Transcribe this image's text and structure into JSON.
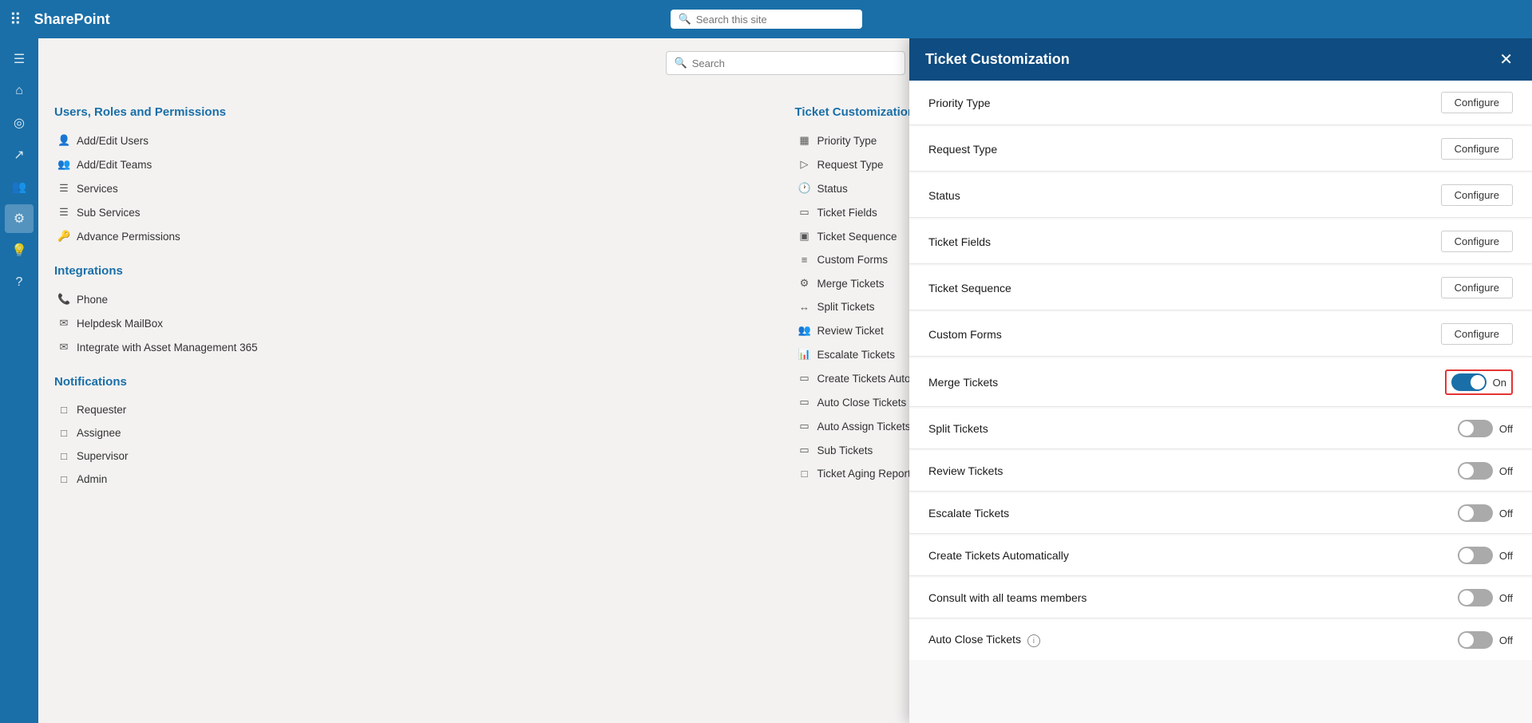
{
  "topbar": {
    "brand": "SharePoint",
    "search_placeholder": "Search this site"
  },
  "sidebar": {
    "icons": [
      {
        "name": "hamburger-icon",
        "symbol": "☰"
      },
      {
        "name": "home-icon",
        "symbol": "⌂"
      },
      {
        "name": "globe-icon",
        "symbol": "◎"
      },
      {
        "name": "chart-icon",
        "symbol": "↗"
      },
      {
        "name": "people-icon",
        "symbol": "👥"
      },
      {
        "name": "settings-icon",
        "symbol": "⚙",
        "active": true
      },
      {
        "name": "bulb-icon",
        "symbol": "💡"
      },
      {
        "name": "help-icon",
        "symbol": "?"
      }
    ]
  },
  "content_search": {
    "placeholder": "Search"
  },
  "sections": [
    {
      "id": "users-roles",
      "title": "Users, Roles and Permissions",
      "items": [
        {
          "label": "Add/Edit Users",
          "icon": "👤"
        },
        {
          "label": "Add/Edit Teams",
          "icon": "👥"
        },
        {
          "label": "Services",
          "icon": "☰"
        },
        {
          "label": "Sub Services",
          "icon": "☰"
        },
        {
          "label": "Advance Permissions",
          "icon": "🔑"
        }
      ]
    },
    {
      "id": "integrations",
      "title": "Integrations",
      "items": [
        {
          "label": "Phone",
          "icon": "📞"
        },
        {
          "label": "Helpdesk MailBox",
          "icon": "✉"
        },
        {
          "label": "Integrate with Asset Management 365",
          "icon": "✉"
        }
      ]
    },
    {
      "id": "notifications",
      "title": "Notifications",
      "items": [
        {
          "label": "Requester",
          "icon": "□"
        },
        {
          "label": "Assignee",
          "icon": "□"
        },
        {
          "label": "Supervisor",
          "icon": "□"
        },
        {
          "label": "Admin",
          "icon": "□"
        }
      ]
    }
  ],
  "ticket_section": {
    "title": "Ticket Customization",
    "items": [
      {
        "label": "Priority Type",
        "icon": "▦"
      },
      {
        "label": "Request Type",
        "icon": "▷"
      },
      {
        "label": "Status",
        "icon": "🕐"
      },
      {
        "label": "Ticket Fields",
        "icon": "▭"
      },
      {
        "label": "Ticket Sequence",
        "icon": "▣"
      },
      {
        "label": "Custom Forms",
        "icon": "≡"
      },
      {
        "label": "Merge Tickets",
        "icon": "⚙"
      },
      {
        "label": "Split Tickets",
        "icon": "↔"
      },
      {
        "label": "Review Ticket",
        "icon": "👥"
      },
      {
        "label": "Escalate Tickets",
        "icon": "📊"
      },
      {
        "label": "Create Tickets Automa...",
        "icon": "▭"
      },
      {
        "label": "Auto Close Tickets",
        "icon": "▭"
      },
      {
        "label": "Auto Assign Tickets",
        "icon": "▭"
      },
      {
        "label": "Sub Tickets",
        "icon": "▭"
      },
      {
        "label": "Ticket Aging Reports",
        "icon": "□"
      }
    ]
  },
  "panel": {
    "title": "Ticket Customization",
    "close_label": "✕",
    "rows": [
      {
        "id": "priority-type",
        "label": "Priority Type",
        "type": "configure",
        "btn_label": "Configure"
      },
      {
        "id": "request-type",
        "label": "Request Type",
        "type": "configure",
        "btn_label": "Configure"
      },
      {
        "id": "status",
        "label": "Status",
        "type": "configure",
        "btn_label": "Configure"
      },
      {
        "id": "ticket-fields",
        "label": "Ticket Fields",
        "type": "configure",
        "btn_label": "Configure"
      },
      {
        "id": "ticket-sequence",
        "label": "Ticket Sequence",
        "type": "configure",
        "btn_label": "Configure"
      },
      {
        "id": "custom-forms",
        "label": "Custom Forms",
        "type": "configure",
        "btn_label": "Configure"
      },
      {
        "id": "merge-tickets",
        "label": "Merge Tickets",
        "type": "toggle",
        "checked": true,
        "toggle_label": "On",
        "highlight": true
      },
      {
        "id": "split-tickets",
        "label": "Split Tickets",
        "type": "toggle",
        "checked": false,
        "toggle_label": "Off"
      },
      {
        "id": "review-tickets",
        "label": "Review Tickets",
        "type": "toggle",
        "checked": false,
        "toggle_label": "Off"
      },
      {
        "id": "escalate-tickets",
        "label": "Escalate Tickets",
        "type": "toggle",
        "checked": false,
        "toggle_label": "Off"
      },
      {
        "id": "create-tickets-auto",
        "label": "Create Tickets Automatically",
        "type": "toggle",
        "checked": false,
        "toggle_label": "Off"
      },
      {
        "id": "consult-teams",
        "label": "Consult with all teams members",
        "type": "toggle",
        "checked": false,
        "toggle_label": "Off"
      },
      {
        "id": "auto-close-tickets",
        "label": "Auto Close Tickets",
        "type": "toggle",
        "checked": false,
        "toggle_label": "Off",
        "info": true
      }
    ]
  }
}
